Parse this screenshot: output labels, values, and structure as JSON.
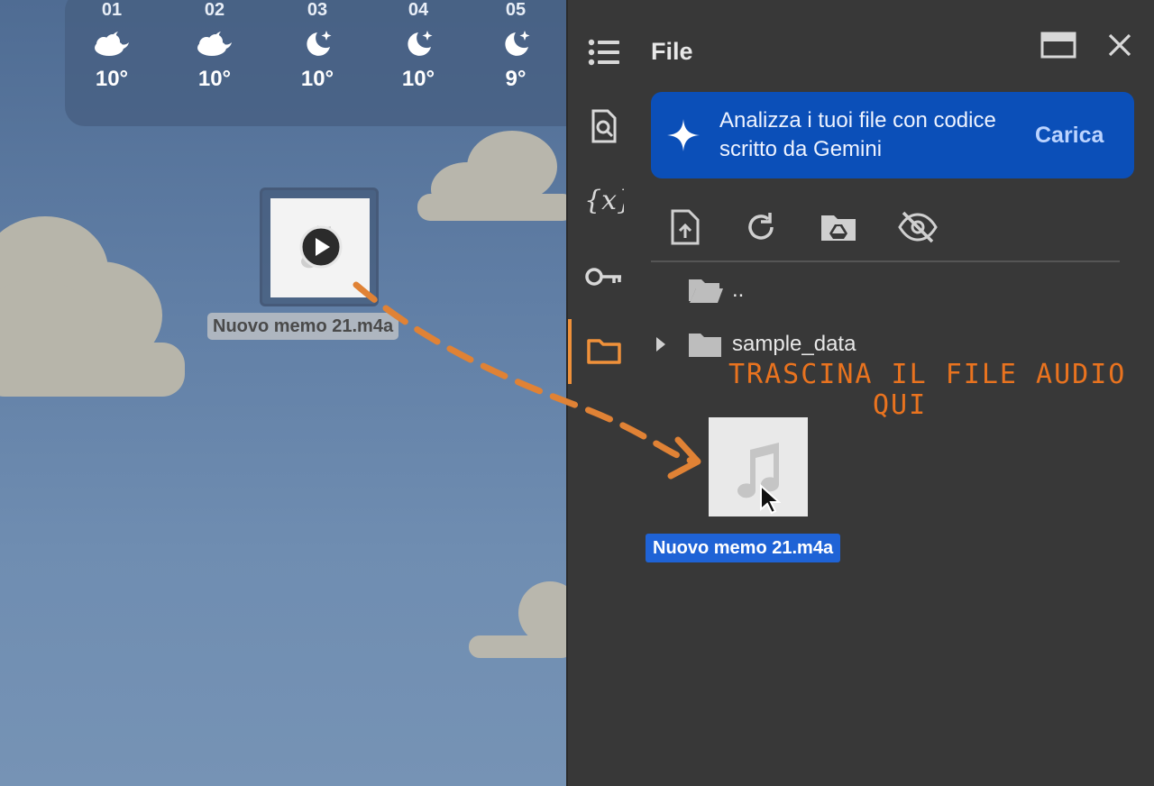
{
  "weather": {
    "hours": [
      {
        "hour": "01",
        "icon": "partly-cloudy-night-icon",
        "temp": "10°"
      },
      {
        "hour": "02",
        "icon": "partly-cloudy-night-icon",
        "temp": "10°"
      },
      {
        "hour": "03",
        "icon": "clear-night-icon",
        "temp": "10°"
      },
      {
        "hour": "04",
        "icon": "clear-night-icon",
        "temp": "10°"
      },
      {
        "hour": "05",
        "icon": "clear-night-icon",
        "temp": "9°"
      }
    ]
  },
  "desktop": {
    "file_name": "Nuovo memo 21.m4a"
  },
  "panel": {
    "title": "File",
    "banner": {
      "text": "Analizza i tuoi file con codice scritto da Gemini",
      "button": "Carica"
    },
    "tree": {
      "parent": "..",
      "folder": "sample_data"
    },
    "annotation": {
      "line1": "TRASCINA IL FILE AUDIO",
      "line2": "QUI"
    },
    "dragged_file_name": "Nuovo memo 21.m4a"
  },
  "colors": {
    "accent_orange": "#f0913a",
    "banner_blue": "#0b4fb8",
    "selection_blue": "#1f63d6",
    "annotation_orange": "#e9731f"
  }
}
